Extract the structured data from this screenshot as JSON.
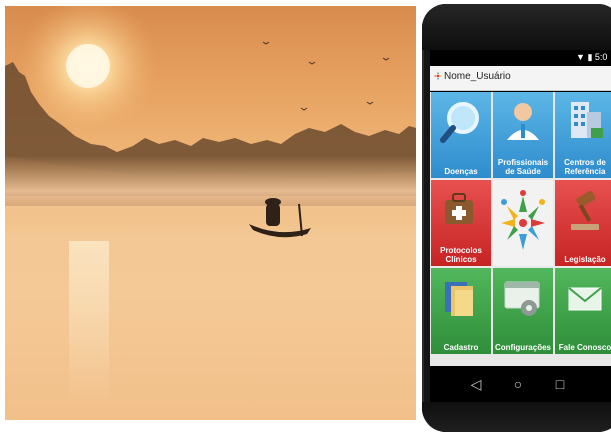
{
  "photo": {
    "subject": "river-sunrise-canoe"
  },
  "phone": {
    "status": {
      "time": "5:0",
      "icons": "wifi-icon battery-icon"
    },
    "appbar": {
      "title": "Nome_Usuário"
    },
    "tiles": [
      {
        "label": "Doenças",
        "color": "blue",
        "icon": "magnifier-icon"
      },
      {
        "label": "Profissionais de Saúde",
        "color": "blue",
        "icon": "doctor-icon"
      },
      {
        "label": "Centros de Referência",
        "color": "blue",
        "icon": "building-icon"
      },
      {
        "label": "Protocolos Clínicos",
        "color": "red",
        "icon": "medical-bag-icon"
      },
      {
        "label": "",
        "color": "white",
        "icon": "logo-people-icon"
      },
      {
        "label": "Legislação",
        "color": "red",
        "icon": "gavel-icon"
      },
      {
        "label": "Cadastro",
        "color": "green",
        "icon": "folder-icon"
      },
      {
        "label": "Configurações",
        "color": "green",
        "icon": "settings-icon"
      },
      {
        "label": "Fale Conosco",
        "color": "green",
        "icon": "envelope-icon"
      }
    ],
    "nav": {
      "back": "◁",
      "home": "○",
      "recent": "□"
    },
    "colors": {
      "blue": "#3b9ed8",
      "red": "#d83434",
      "green": "#3fa049"
    }
  }
}
